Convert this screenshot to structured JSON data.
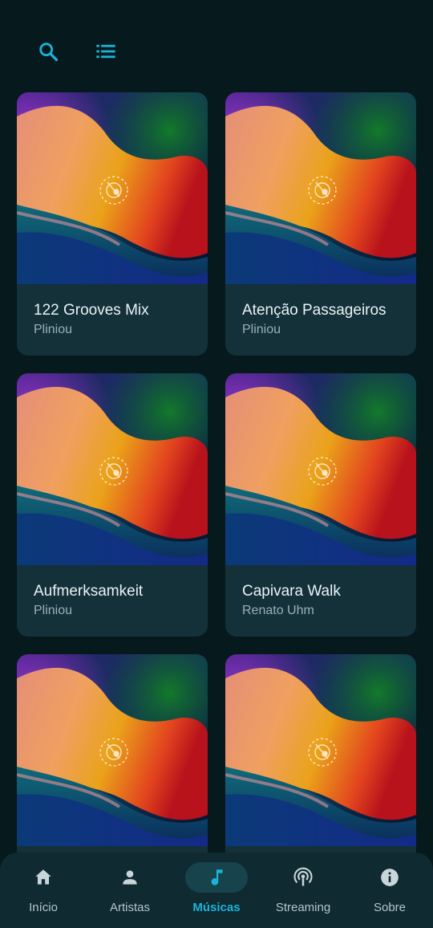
{
  "toolbar": {
    "icons": [
      "search-icon",
      "list-icon"
    ],
    "accent": "#1ab4d8"
  },
  "songs": [
    {
      "title": "122 Grooves Mix",
      "artist": "Pliniou"
    },
    {
      "title": "Atenção Passageiros",
      "artist": "Pliniou"
    },
    {
      "title": "Aufmerksamkeit",
      "artist": "Pliniou"
    },
    {
      "title": "Capivara Walk",
      "artist": "Renato Uhm"
    },
    {
      "title": "",
      "artist": ""
    },
    {
      "title": "",
      "artist": ""
    }
  ],
  "nav": {
    "items": [
      {
        "label": "Início",
        "icon": "home-icon",
        "active": false
      },
      {
        "label": "Artistas",
        "icon": "person-icon",
        "active": false
      },
      {
        "label": "Músicas",
        "icon": "music-note-icon",
        "active": true
      },
      {
        "label": "Streaming",
        "icon": "podcast-icon",
        "active": false
      },
      {
        "label": "Sobre",
        "icon": "info-icon",
        "active": false
      }
    ]
  },
  "colors": {
    "background": "#06191d",
    "card": "#143139",
    "nav": "#0f2a31",
    "accent": "#1ab4d8"
  }
}
